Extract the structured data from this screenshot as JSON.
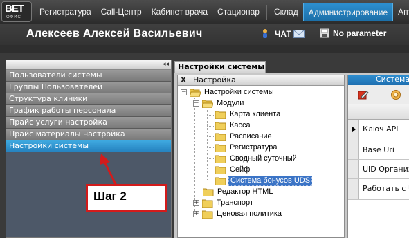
{
  "logo": {
    "main": "ВЕТ",
    "sub": "ОФИС"
  },
  "menu": [
    "Регистратура",
    "Call-Центр",
    "Кабинет врача",
    "Стационар",
    "Склад",
    "Администрирование",
    "Аптека"
  ],
  "active_menu": "Администрирование",
  "user": {
    "name": "Алексеев Алексей Васильевич",
    "chat_label": "ЧАТ",
    "param_label": "No parameter"
  },
  "left_panel": {
    "items": [
      "Пользователи системы",
      "Группы Пользователей",
      "Структура клиники",
      "График работы персонала",
      "Прайс услуги настройка",
      "Прайс материалы настройка",
      "Настройки системы"
    ],
    "selected": "Настройки системы"
  },
  "annotation": {
    "step": "Шаг 2"
  },
  "main_tab": {
    "label": "Настройки системы"
  },
  "tree": {
    "header": "Настройка",
    "close_glyph": "X",
    "root": "Настройки системы",
    "modules": "Модули",
    "module_items": [
      "Карта клиента",
      "Касса",
      "Расписание",
      "Регистратура",
      "Сводный суточный",
      "Сейф",
      "Система бонусов UDS"
    ],
    "selected": "Система бонусов UDS",
    "other": [
      "Редактор HTML",
      "Транспорт",
      "Ценовая политика"
    ]
  },
  "grid": {
    "header": "Система",
    "rows": [
      "Ключ API",
      "Base Uri",
      "UID Организа",
      "Работать с U"
    ]
  },
  "colors": {
    "accent": "#2683c0",
    "annotation": "#d31b1b",
    "selection": "#3b74c6"
  }
}
